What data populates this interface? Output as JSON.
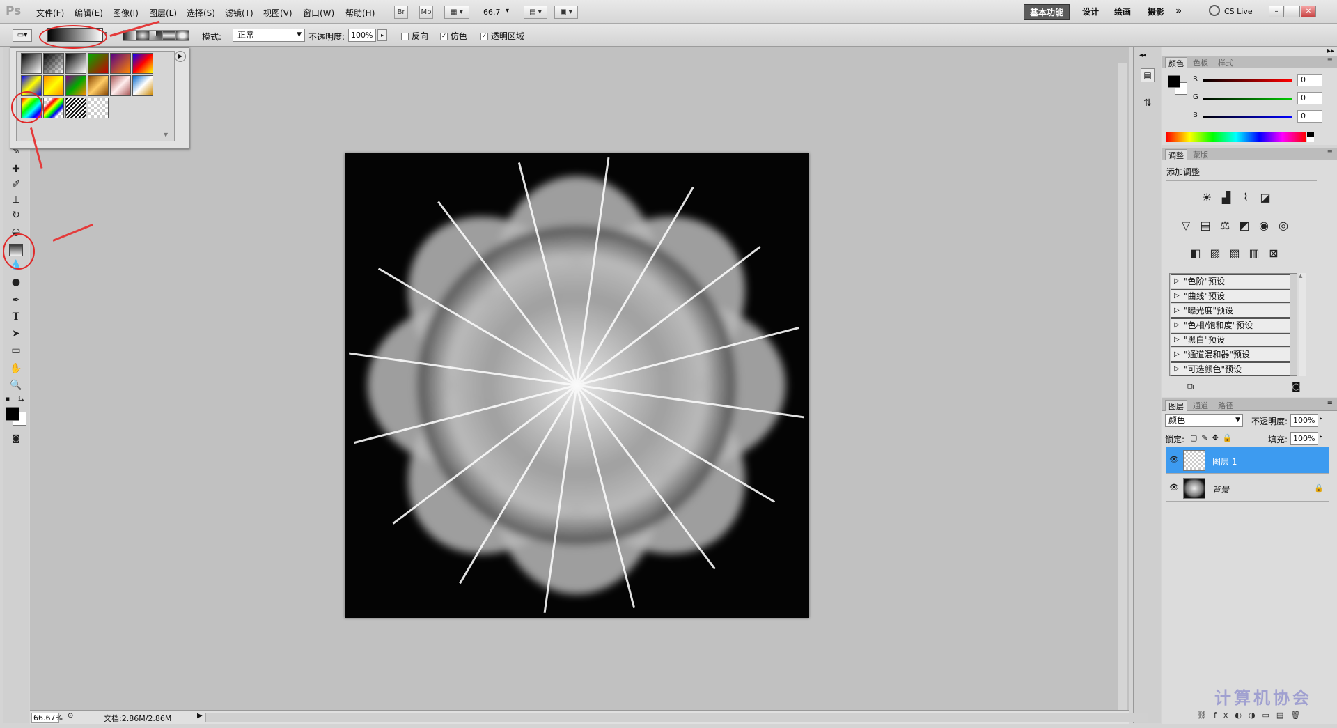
{
  "app": {
    "logo": "Ps"
  },
  "menu": [
    "文件(F)",
    "编辑(E)",
    "图像(I)",
    "图层(L)",
    "选择(S)",
    "滤镜(T)",
    "视图(V)",
    "窗口(W)",
    "帮助(H)"
  ],
  "menubar_buttons": {
    "br": "Br",
    "mb": "Mb",
    "zoom": "66.7"
  },
  "workspaces": [
    "基本功能",
    "设计",
    "绘画",
    "摄影"
  ],
  "cs_live": "CS Live",
  "options": {
    "mode_label": "模式:",
    "mode_value": "正常",
    "opacity_label": "不透明度:",
    "opacity_value": "100%",
    "reverse": "反向",
    "dither": "仿色",
    "transparency": "透明区域"
  },
  "status": {
    "zoom": "66.67%",
    "doc": "文档:2.86M/2.86M"
  },
  "color_panel": {
    "tabs": [
      "颜色",
      "色板",
      "样式"
    ],
    "r_label": "R",
    "g_label": "G",
    "b_label": "B",
    "r": "0",
    "g": "0",
    "b": "0"
  },
  "adjust_panel": {
    "tabs": [
      "调整",
      "蒙版"
    ],
    "title": "添加调整",
    "presets": [
      "\"色阶\"预设",
      "\"曲线\"预设",
      "\"曝光度\"预设",
      "\"色相/饱和度\"预设",
      "\"黑白\"预设",
      "\"通道混和器\"预设",
      "\"可选颜色\"预设"
    ]
  },
  "layers_panel": {
    "tabs": [
      "图层",
      "通道",
      "路径"
    ],
    "blend": "颜色",
    "opacity_label": "不透明度:",
    "opacity": "100%",
    "lock_label": "锁定:",
    "fill_label": "填充:",
    "fill": "100%",
    "layers": [
      "图层 1",
      "背景"
    ]
  },
  "watermark": "计算机协会",
  "colors": {
    "accent": "#3d9bf0",
    "annotation": "#e02a2a"
  }
}
